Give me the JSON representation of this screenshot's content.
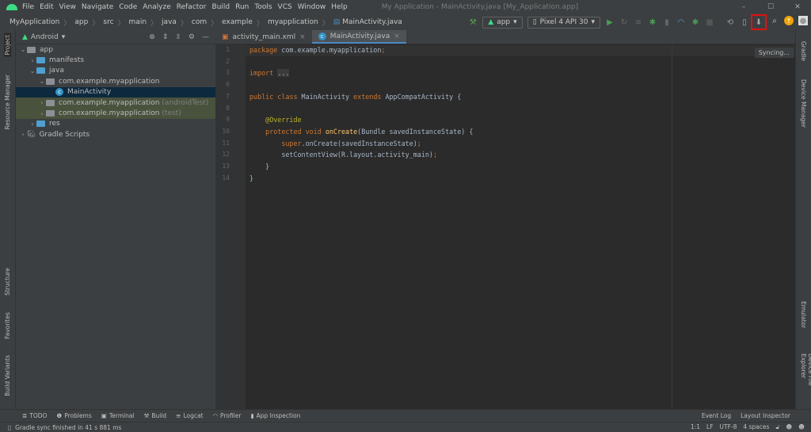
{
  "menu": [
    "File",
    "Edit",
    "View",
    "Navigate",
    "Code",
    "Analyze",
    "Refactor",
    "Build",
    "Run",
    "Tools",
    "VCS",
    "Window",
    "Help"
  ],
  "window_title": "My Application - MainActivity.java [My_Application.app]",
  "breadcrumb": [
    "MyApplication",
    "app",
    "src",
    "main",
    "java",
    "com",
    "example",
    "myapplication",
    "MainActivity.java"
  ],
  "toolbar": {
    "run_config": "app",
    "device": "Pixel 4 API 30",
    "highlighted": "sdk-manager",
    "highlight_color": "#e01010"
  },
  "project": {
    "view": "Android",
    "tree": [
      {
        "label": "app",
        "depth": 0,
        "open": true,
        "icon": "module"
      },
      {
        "label": "manifests",
        "depth": 1,
        "open": false,
        "icon": "folder"
      },
      {
        "label": "java",
        "depth": 1,
        "open": true,
        "icon": "folder"
      },
      {
        "label": "com.example.myapplication",
        "depth": 2,
        "open": true,
        "icon": "package"
      },
      {
        "label": "MainActivity",
        "depth": 3,
        "icon": "class",
        "selected": true
      },
      {
        "label": "com.example.myapplication",
        "suffix": "(androidTest)",
        "depth": 2,
        "open": false,
        "icon": "package",
        "test": true
      },
      {
        "label": "com.example.myapplication",
        "suffix": "(test)",
        "depth": 2,
        "open": false,
        "icon": "package",
        "test": true
      },
      {
        "label": "res",
        "depth": 1,
        "open": false,
        "icon": "folder"
      },
      {
        "label": "Gradle Scripts",
        "depth": 0,
        "open": false,
        "icon": "gradle"
      }
    ]
  },
  "tabs": [
    {
      "label": "activity_main.xml",
      "active": false
    },
    {
      "label": "MainActivity.java",
      "active": true
    }
  ],
  "editor": {
    "lines": [
      {
        "n": "1",
        "t": [
          [
            "package",
            "kw"
          ],
          [
            " com.example.myapplication",
            ""
          ],
          [
            ";",
            "kw"
          ]
        ]
      },
      {
        "n": "2",
        "t": []
      },
      {
        "n": "3",
        "t": [
          [
            "import",
            "kw"
          ],
          [
            " ",
            ""
          ],
          [
            "...",
            "fold-t"
          ]
        ]
      },
      {
        "n": "6",
        "t": []
      },
      {
        "n": "7",
        "t": [
          [
            "public class",
            "kw"
          ],
          [
            " MainActivity ",
            ""
          ],
          [
            "extends",
            "kw"
          ],
          [
            " AppCompatActivity {",
            ""
          ]
        ]
      },
      {
        "n": "8",
        "t": []
      },
      {
        "n": "9",
        "t": [
          [
            "    @Override",
            "an"
          ]
        ]
      },
      {
        "n": "10",
        "t": [
          [
            "    protected void",
            "kw"
          ],
          [
            " ",
            ""
          ],
          [
            "onCreate",
            "fn"
          ],
          [
            "(Bundle savedInstanceState) {",
            ""
          ]
        ]
      },
      {
        "n": "11",
        "t": [
          [
            "        super",
            "kw"
          ],
          [
            ".onCreate(savedInstanceState)",
            ""
          ],
          [
            ";",
            "kw"
          ]
        ]
      },
      {
        "n": "12",
        "t": [
          [
            "        setContentView(R.layout.activity_main)",
            ""
          ],
          [
            ";",
            "kw"
          ]
        ]
      },
      {
        "n": "13",
        "t": [
          [
            "    }",
            ""
          ]
        ]
      },
      {
        "n": "14",
        "t": [
          [
            "}",
            ""
          ]
        ]
      }
    ],
    "status_popup": "Syncing..."
  },
  "left_strip": [
    "Project",
    "Resource Manager",
    "Structure",
    "Favorites",
    "Build Variants"
  ],
  "right_strip": [
    "Gradle",
    "Device Manager",
    "Emulator",
    "Device File Explorer"
  ],
  "tool_windows": [
    "TODO",
    "Problems",
    "Terminal",
    "Build",
    "Logcat",
    "Profiler",
    "App Inspection"
  ],
  "tool_windows_right": [
    "Event Log",
    "Layout Inspector"
  ],
  "status": {
    "message": "Gradle sync finished in 41 s 881 ms",
    "position": "1:1",
    "line_sep": "LF",
    "encoding": "UTF-8",
    "indent": "4 spaces"
  }
}
